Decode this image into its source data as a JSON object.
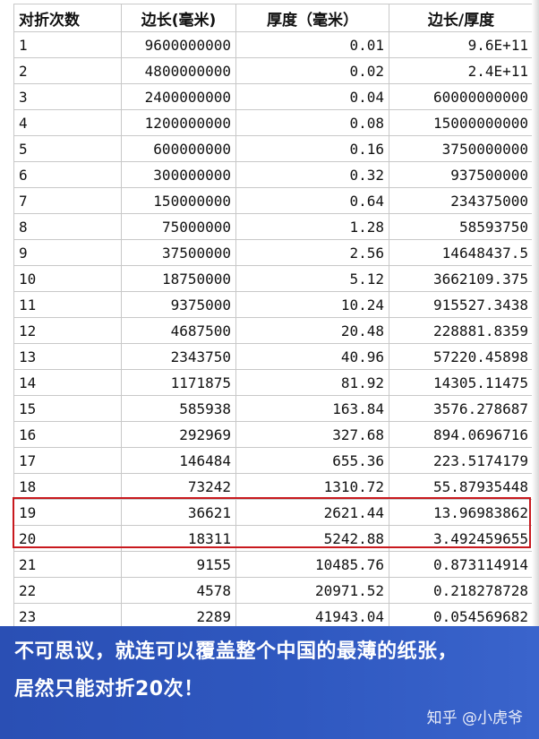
{
  "table": {
    "headers": [
      "对折次数",
      "边长(毫米)",
      "厚度（毫米）",
      "边长/厚度"
    ],
    "rows": [
      [
        "1",
        "9600000000",
        "0.01",
        "9.6E+11"
      ],
      [
        "2",
        "4800000000",
        "0.02",
        "2.4E+11"
      ],
      [
        "3",
        "2400000000",
        "0.04",
        "60000000000"
      ],
      [
        "4",
        "1200000000",
        "0.08",
        "15000000000"
      ],
      [
        "5",
        "600000000",
        "0.16",
        "3750000000"
      ],
      [
        "6",
        "300000000",
        "0.32",
        "937500000"
      ],
      [
        "7",
        "150000000",
        "0.64",
        "234375000"
      ],
      [
        "8",
        "75000000",
        "1.28",
        "58593750"
      ],
      [
        "9",
        "37500000",
        "2.56",
        "14648437.5"
      ],
      [
        "10",
        "18750000",
        "5.12",
        "3662109.375"
      ],
      [
        "11",
        "9375000",
        "10.24",
        "915527.3438"
      ],
      [
        "12",
        "4687500",
        "20.48",
        "228881.8359"
      ],
      [
        "13",
        "2343750",
        "40.96",
        "57220.45898"
      ],
      [
        "14",
        "1171875",
        "81.92",
        "14305.11475"
      ],
      [
        "15",
        "585938",
        "163.84",
        "3576.278687"
      ],
      [
        "16",
        "292969",
        "327.68",
        "894.0696716"
      ],
      [
        "17",
        "146484",
        "655.36",
        "223.5174179"
      ],
      [
        "18",
        "73242",
        "1310.72",
        "55.87935448"
      ],
      [
        "19",
        "36621",
        "2621.44",
        "13.96983862"
      ],
      [
        "20",
        "18311",
        "5242.88",
        "3.492459655"
      ],
      [
        "21",
        "9155",
        "10485.76",
        "0.873114914"
      ],
      [
        "22",
        "4578",
        "20971.52",
        "0.218278728"
      ],
      [
        "23",
        "2289",
        "41943.04",
        "0.054569682"
      ]
    ]
  },
  "caption": {
    "line1": "不可思议，就连可以覆盖整个中国的最薄的纸张，",
    "line2": "居然只能对折20次！",
    "watermark": "知乎 @小虎爷"
  },
  "colors": {
    "highlight_border": "#c8191e",
    "caption_bg": "#2f58c0"
  }
}
